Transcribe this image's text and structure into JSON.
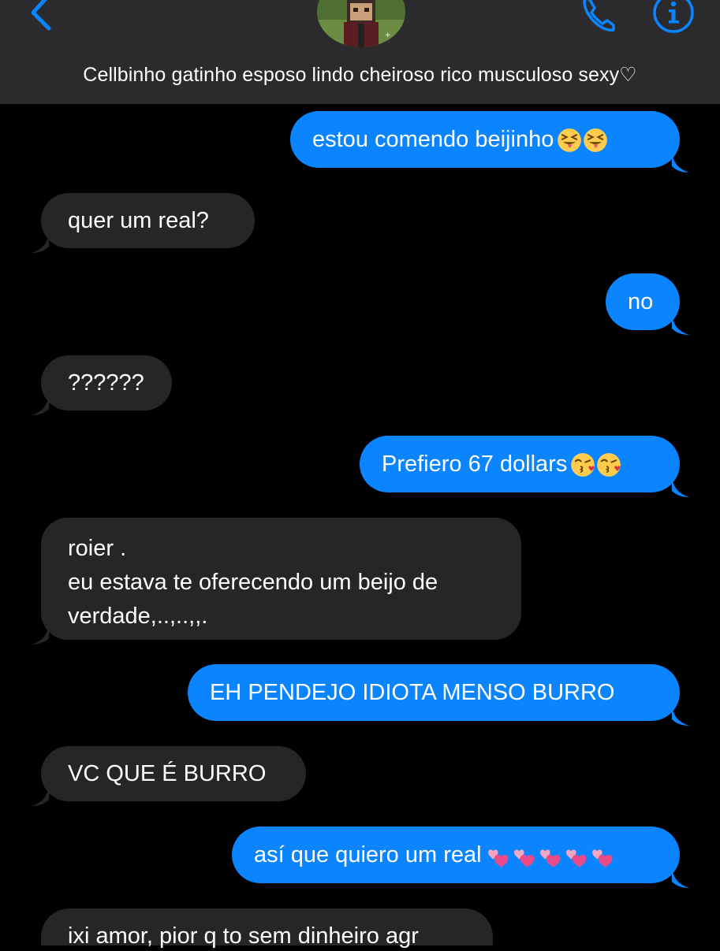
{
  "header": {
    "contact_name": "Cellbinho gatinho esposo lindo cheiroso rico musculoso sexy♡",
    "colors": {
      "background": "#2b2b2d",
      "accent": "#0a84ff"
    },
    "icons": [
      "chevron-left-icon",
      "phone-icon",
      "info-icon"
    ]
  },
  "messages": [
    {
      "direction": "sent",
      "text": "estou comendo beijinho",
      "emoji": [
        "squinting-tongue-face",
        "squinting-tongue-face"
      ]
    },
    {
      "direction": "received",
      "text": "quer um real?"
    },
    {
      "direction": "sent",
      "text": "no"
    },
    {
      "direction": "received",
      "text": "??????"
    },
    {
      "direction": "sent",
      "text": "Prefiero 67 dollars",
      "emoji": [
        "face-blowing-kiss",
        "face-blowing-kiss"
      ]
    },
    {
      "direction": "received",
      "lines": [
        "roier .",
        "eu estava te oferecendo um beijo de",
        "verdade,..,..,,."
      ]
    },
    {
      "direction": "sent",
      "text": "EH PENDEJO IDIOTA MENSO BURRO"
    },
    {
      "direction": "received",
      "text": "VC QUE É BURRO"
    },
    {
      "direction": "sent",
      "text": "así que quiero um real",
      "emoji": [
        "two-hearts",
        "two-hearts",
        "two-hearts",
        "two-hearts",
        "two-hearts"
      ]
    },
    {
      "direction": "received",
      "text": "ixi amor, pior q to sem dinheiro agr"
    }
  ],
  "colors": {
    "sent_bubble": "#0a84ff",
    "received_bubble": "#262629",
    "background": "#000000"
  }
}
